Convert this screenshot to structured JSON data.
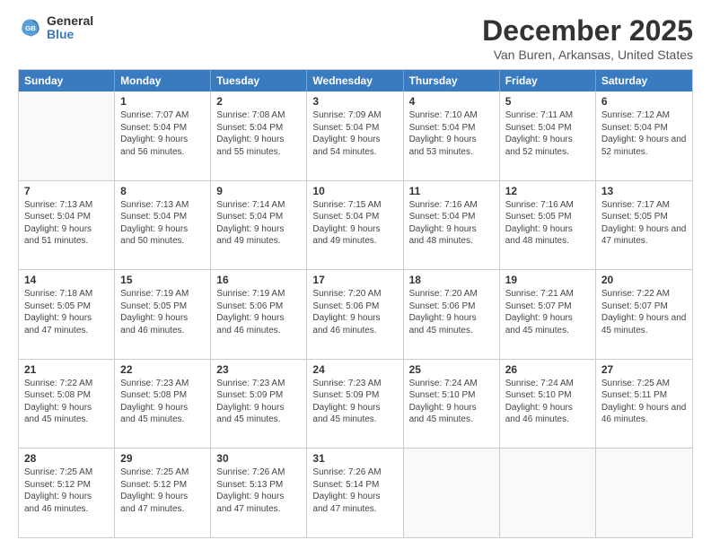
{
  "logo": {
    "general": "General",
    "blue": "Blue"
  },
  "title": "December 2025",
  "subtitle": "Van Buren, Arkansas, United States",
  "header_days": [
    "Sunday",
    "Monday",
    "Tuesday",
    "Wednesday",
    "Thursday",
    "Friday",
    "Saturday"
  ],
  "weeks": [
    [
      {
        "day": "",
        "empty": true
      },
      {
        "day": "1",
        "sunrise": "7:07 AM",
        "sunset": "5:04 PM",
        "daylight": "9 hours and 56 minutes."
      },
      {
        "day": "2",
        "sunrise": "7:08 AM",
        "sunset": "5:04 PM",
        "daylight": "9 hours and 55 minutes."
      },
      {
        "day": "3",
        "sunrise": "7:09 AM",
        "sunset": "5:04 PM",
        "daylight": "9 hours and 54 minutes."
      },
      {
        "day": "4",
        "sunrise": "7:10 AM",
        "sunset": "5:04 PM",
        "daylight": "9 hours and 53 minutes."
      },
      {
        "day": "5",
        "sunrise": "7:11 AM",
        "sunset": "5:04 PM",
        "daylight": "9 hours and 52 minutes."
      },
      {
        "day": "6",
        "sunrise": "7:12 AM",
        "sunset": "5:04 PM",
        "daylight": "9 hours and 52 minutes."
      }
    ],
    [
      {
        "day": "7",
        "sunrise": "7:13 AM",
        "sunset": "5:04 PM",
        "daylight": "9 hours and 51 minutes."
      },
      {
        "day": "8",
        "sunrise": "7:13 AM",
        "sunset": "5:04 PM",
        "daylight": "9 hours and 50 minutes."
      },
      {
        "day": "9",
        "sunrise": "7:14 AM",
        "sunset": "5:04 PM",
        "daylight": "9 hours and 49 minutes."
      },
      {
        "day": "10",
        "sunrise": "7:15 AM",
        "sunset": "5:04 PM",
        "daylight": "9 hours and 49 minutes."
      },
      {
        "day": "11",
        "sunrise": "7:16 AM",
        "sunset": "5:04 PM",
        "daylight": "9 hours and 48 minutes."
      },
      {
        "day": "12",
        "sunrise": "7:16 AM",
        "sunset": "5:05 PM",
        "daylight": "9 hours and 48 minutes."
      },
      {
        "day": "13",
        "sunrise": "7:17 AM",
        "sunset": "5:05 PM",
        "daylight": "9 hours and 47 minutes."
      }
    ],
    [
      {
        "day": "14",
        "sunrise": "7:18 AM",
        "sunset": "5:05 PM",
        "daylight": "9 hours and 47 minutes."
      },
      {
        "day": "15",
        "sunrise": "7:19 AM",
        "sunset": "5:05 PM",
        "daylight": "9 hours and 46 minutes."
      },
      {
        "day": "16",
        "sunrise": "7:19 AM",
        "sunset": "5:06 PM",
        "daylight": "9 hours and 46 minutes."
      },
      {
        "day": "17",
        "sunrise": "7:20 AM",
        "sunset": "5:06 PM",
        "daylight": "9 hours and 46 minutes."
      },
      {
        "day": "18",
        "sunrise": "7:20 AM",
        "sunset": "5:06 PM",
        "daylight": "9 hours and 45 minutes."
      },
      {
        "day": "19",
        "sunrise": "7:21 AM",
        "sunset": "5:07 PM",
        "daylight": "9 hours and 45 minutes."
      },
      {
        "day": "20",
        "sunrise": "7:22 AM",
        "sunset": "5:07 PM",
        "daylight": "9 hours and 45 minutes."
      }
    ],
    [
      {
        "day": "21",
        "sunrise": "7:22 AM",
        "sunset": "5:08 PM",
        "daylight": "9 hours and 45 minutes."
      },
      {
        "day": "22",
        "sunrise": "7:23 AM",
        "sunset": "5:08 PM",
        "daylight": "9 hours and 45 minutes."
      },
      {
        "day": "23",
        "sunrise": "7:23 AM",
        "sunset": "5:09 PM",
        "daylight": "9 hours and 45 minutes."
      },
      {
        "day": "24",
        "sunrise": "7:23 AM",
        "sunset": "5:09 PM",
        "daylight": "9 hours and 45 minutes."
      },
      {
        "day": "25",
        "sunrise": "7:24 AM",
        "sunset": "5:10 PM",
        "daylight": "9 hours and 45 minutes."
      },
      {
        "day": "26",
        "sunrise": "7:24 AM",
        "sunset": "5:10 PM",
        "daylight": "9 hours and 46 minutes."
      },
      {
        "day": "27",
        "sunrise": "7:25 AM",
        "sunset": "5:11 PM",
        "daylight": "9 hours and 46 minutes."
      }
    ],
    [
      {
        "day": "28",
        "sunrise": "7:25 AM",
        "sunset": "5:12 PM",
        "daylight": "9 hours and 46 minutes."
      },
      {
        "day": "29",
        "sunrise": "7:25 AM",
        "sunset": "5:12 PM",
        "daylight": "9 hours and 47 minutes."
      },
      {
        "day": "30",
        "sunrise": "7:26 AM",
        "sunset": "5:13 PM",
        "daylight": "9 hours and 47 minutes."
      },
      {
        "day": "31",
        "sunrise": "7:26 AM",
        "sunset": "5:14 PM",
        "daylight": "9 hours and 47 minutes."
      },
      {
        "day": "",
        "empty": true
      },
      {
        "day": "",
        "empty": true
      },
      {
        "day": "",
        "empty": true
      }
    ]
  ]
}
